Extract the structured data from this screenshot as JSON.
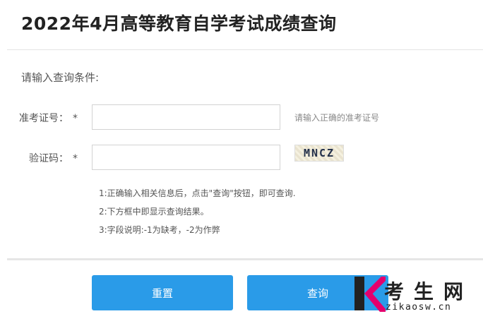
{
  "page": {
    "title": "2022年4月高等教育自学考试成绩查询",
    "prompt": "请输入查询条件:"
  },
  "form": {
    "exam_id": {
      "label": "准考证号：",
      "required_mark": "*",
      "value": "",
      "hint": "请输入正确的准考证号"
    },
    "captcha": {
      "label": "验证码：",
      "required_mark": "*",
      "value": "",
      "image_text": "MNCZ"
    }
  },
  "notes": [
    "1:正确输入相关信息后，点击\"查询\"按钮，即可查询.",
    "2:下方框中即显示查询结果。",
    "3:字段说明:-1为缺考，-2为作弊"
  ],
  "buttons": {
    "reset_label": "重置",
    "query_label": "查询"
  },
  "watermark": {
    "name": "考生网",
    "url": "zikaosw.cn"
  },
  "colors": {
    "button_bg": "#2a9be8",
    "text": "#333333"
  }
}
